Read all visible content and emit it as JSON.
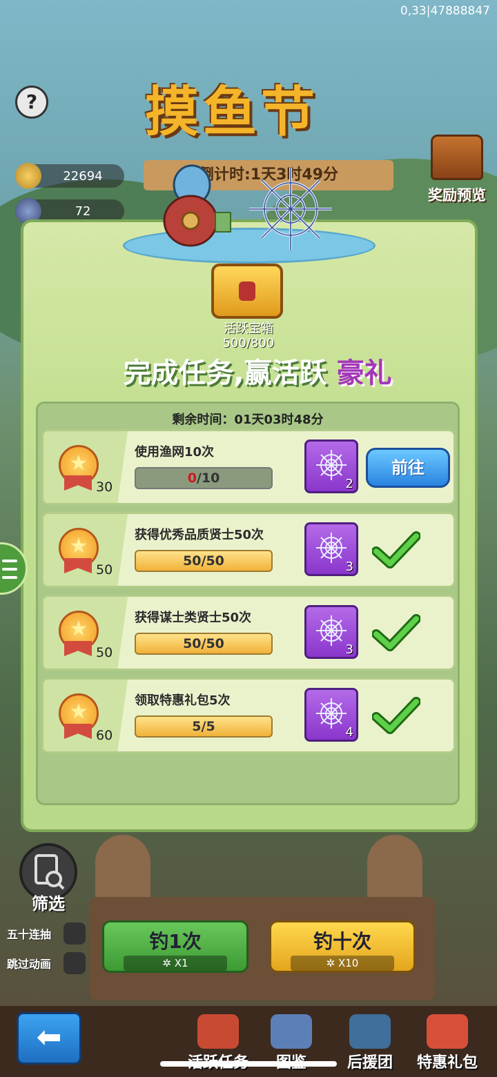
{
  "corner_id": "0,33|47888847",
  "event": {
    "title": "摸鱼节",
    "timer": "倒计时:1天3时49分"
  },
  "help": "?",
  "resources": [
    {
      "name": "gold-ingot",
      "value": "22694"
    },
    {
      "name": "fishing-net",
      "value": "72"
    }
  ],
  "reward_preview": "奖励预览",
  "chest": {
    "name": "活跃宝箱",
    "progress": "500/800"
  },
  "slogan": {
    "main": "完成任务,赢活跃",
    "highlight": "豪礼"
  },
  "remaining": "剩余时间：01天03时48分",
  "tasks": [
    {
      "points": "30",
      "desc": "使用渔网10次",
      "progress_cur": "0",
      "progress_total": "/10",
      "reward_count": "2",
      "status": "go",
      "action": "前往"
    },
    {
      "points": "50",
      "desc": "获得优秀品质贤士50次",
      "progress": "50/50",
      "reward_count": "3",
      "status": "done"
    },
    {
      "points": "50",
      "desc": "获得谋士类贤士50次",
      "progress": "50/50",
      "reward_count": "3",
      "status": "done"
    },
    {
      "points": "60",
      "desc": "领取特惠礼包5次",
      "progress": "5/5",
      "reward_count": "4",
      "status": "done"
    }
  ],
  "controls": {
    "filter": "筛选",
    "opt_fifty": "五十连抽",
    "opt_skip": "跳过动画",
    "fish_once": {
      "label": "钓1次",
      "cost": "X1"
    },
    "fish_ten": {
      "label": "钓十次",
      "cost": "X10"
    }
  },
  "nav": [
    "活跃任务",
    "图鉴",
    "后援团",
    "特惠礼包"
  ],
  "colors": {
    "accent_purple": "#a236b8",
    "go_blue": "#2a84e0",
    "check_green": "#49c23a"
  }
}
